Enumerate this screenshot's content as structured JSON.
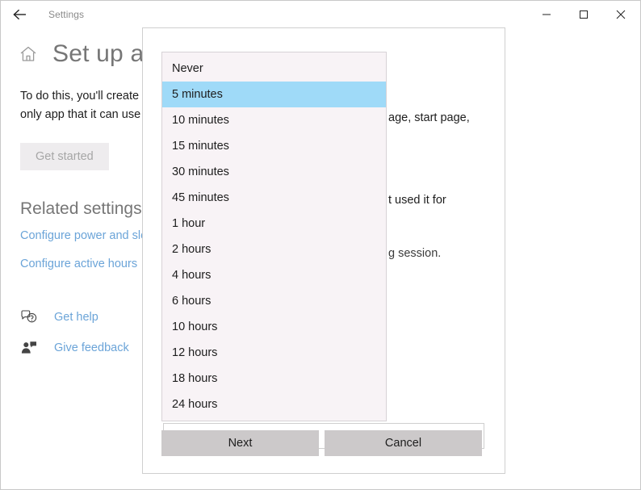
{
  "titlebar": {
    "back_label": "back-arrow",
    "app_title": "Settings",
    "minimize": "minimize",
    "maximize": "maximize",
    "close": "close"
  },
  "page": {
    "home_icon": "home-icon",
    "title": "Set up a k",
    "paragraph_line1": "To do this, you'll create o",
    "paragraph_line2": "only app that it can use (",
    "get_started_label": "Get started",
    "related_heading": "Related settings",
    "related_links": [
      "Configure power and sle",
      "Configure active hours"
    ],
    "footer_links": [
      {
        "icon": "help-chat-icon",
        "label": "Get help"
      },
      {
        "icon": "feedback-person-icon",
        "label": "Give feedback"
      }
    ]
  },
  "dialog": {
    "fragments": [
      "age, start page,",
      "t used it for",
      "g session."
    ],
    "buttons": {
      "next": "Next",
      "cancel": "Cancel"
    }
  },
  "dropdown": {
    "selected_value": "5 minutes",
    "highlight_color": "#9fdaf8",
    "background_color": "#f8f3f6",
    "items": [
      "Never",
      "5 minutes",
      "10 minutes",
      "15 minutes",
      "30 minutes",
      "45 minutes",
      "1 hour",
      "2 hours",
      "4 hours",
      "6 hours",
      "10 hours",
      "12 hours",
      "18 hours",
      "24 hours"
    ]
  }
}
